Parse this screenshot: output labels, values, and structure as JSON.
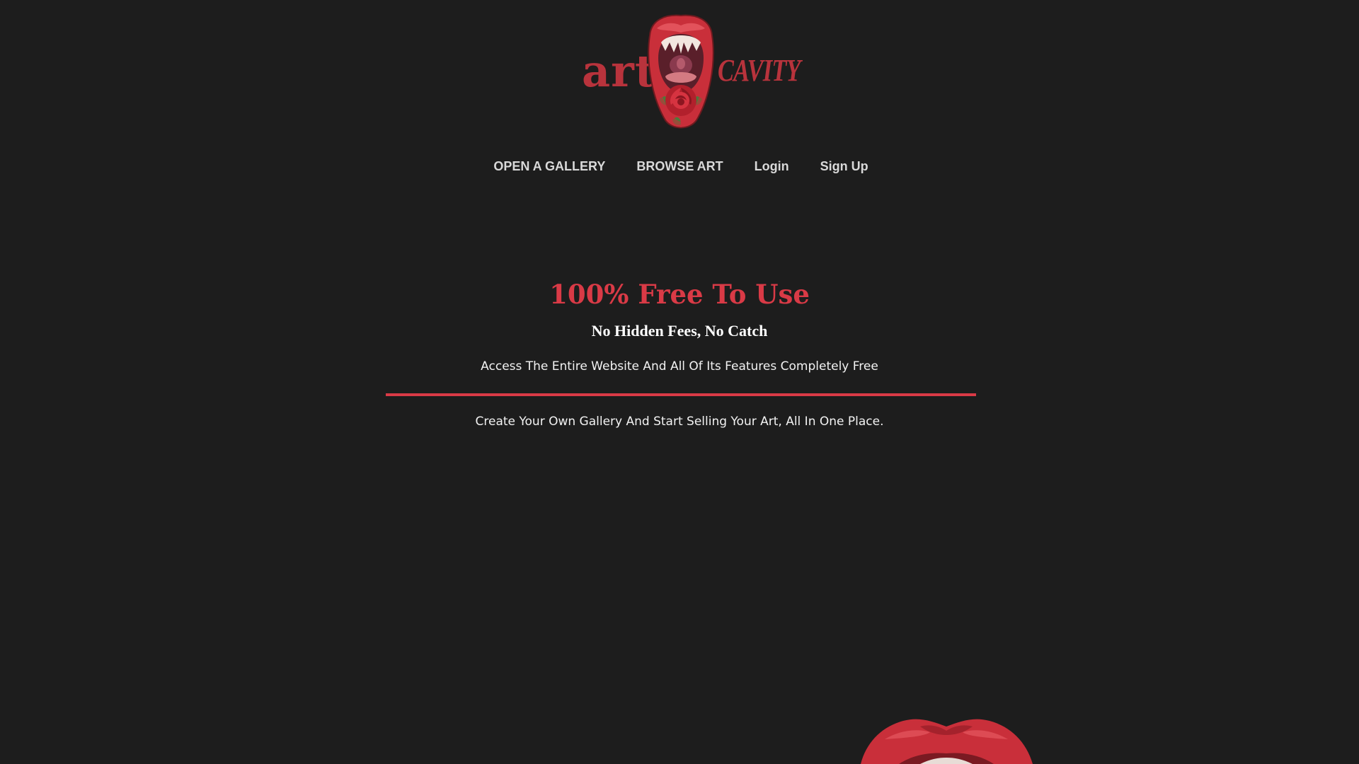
{
  "logo": {
    "word_left": "art",
    "word_right": "CAVITY",
    "icon": "open-mouth-rose-icon",
    "color": "#b8333c"
  },
  "nav": {
    "items": [
      {
        "label": "OPEN A GALLERY"
      },
      {
        "label": "BROWSE ART"
      },
      {
        "label": "Login"
      },
      {
        "label": "Sign Up"
      }
    ]
  },
  "hero": {
    "title": "100% Free To Use",
    "subtitle": "No Hidden Fees, No Catch",
    "description": "Access The Entire Website And All Of Its Features Completely Free",
    "tagline": "Create Your Own Gallery And Start Selling Your Art, All In One Place."
  },
  "decoration": {
    "bottom_icon": "red-lips-icon"
  },
  "colors": {
    "background": "#1d1d1d",
    "accent": "#d93a46",
    "nav_text": "#d9d9d9"
  }
}
